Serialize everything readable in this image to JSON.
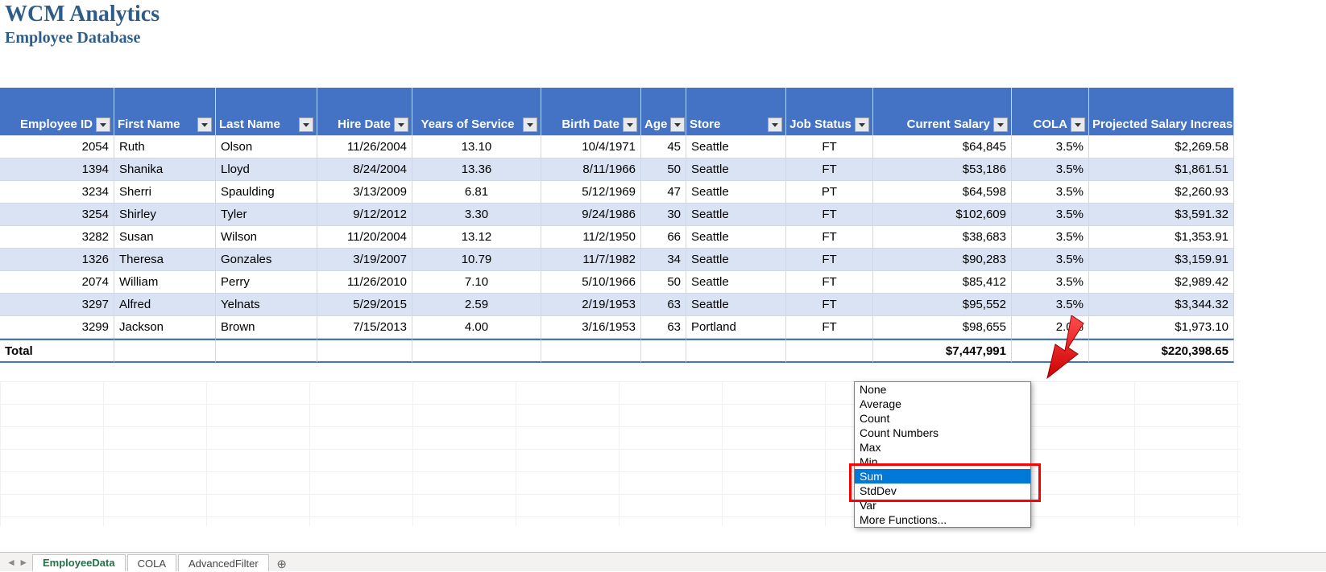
{
  "header": {
    "title1": "WCM Analytics",
    "title2": "Employee Database"
  },
  "columns": [
    {
      "label": "Employee ID",
      "align": "right"
    },
    {
      "label": "First Name",
      "align": "left"
    },
    {
      "label": "Last Name",
      "align": "left"
    },
    {
      "label": "Hire Date",
      "align": "right"
    },
    {
      "label": "Years of Service",
      "align": "center"
    },
    {
      "label": "Birth Date",
      "align": "right"
    },
    {
      "label": "Age",
      "align": "right"
    },
    {
      "label": "Store",
      "align": "left"
    },
    {
      "label": "Job Status",
      "align": "center"
    },
    {
      "label": "Current Salary",
      "align": "right"
    },
    {
      "label": "COLA",
      "align": "right"
    },
    {
      "label": "Projected Salary Increase",
      "align": "right"
    }
  ],
  "rows": [
    {
      "id": "2054",
      "first": "Ruth",
      "last": "Olson",
      "hire": "11/26/2004",
      "yos": "13.10",
      "birth": "10/4/1971",
      "age": "45",
      "store": "Seattle",
      "status": "FT",
      "salary": "$64,845",
      "cola": "3.5%",
      "proj": "$2,269.58"
    },
    {
      "id": "1394",
      "first": "Shanika",
      "last": "Lloyd",
      "hire": "8/24/2004",
      "yos": "13.36",
      "birth": "8/11/1966",
      "age": "50",
      "store": "Seattle",
      "status": "FT",
      "salary": "$53,186",
      "cola": "3.5%",
      "proj": "$1,861.51"
    },
    {
      "id": "3234",
      "first": "Sherri",
      "last": "Spaulding",
      "hire": "3/13/2009",
      "yos": "6.81",
      "birth": "5/12/1969",
      "age": "47",
      "store": "Seattle",
      "status": "PT",
      "salary": "$64,598",
      "cola": "3.5%",
      "proj": "$2,260.93"
    },
    {
      "id": "3254",
      "first": "Shirley",
      "last": "Tyler",
      "hire": "9/12/2012",
      "yos": "3.30",
      "birth": "9/24/1986",
      "age": "30",
      "store": "Seattle",
      "status": "FT",
      "salary": "$102,609",
      "cola": "3.5%",
      "proj": "$3,591.32"
    },
    {
      "id": "3282",
      "first": "Susan",
      "last": "Wilson",
      "hire": "11/20/2004",
      "yos": "13.12",
      "birth": "11/2/1950",
      "age": "66",
      "store": "Seattle",
      "status": "FT",
      "salary": "$38,683",
      "cola": "3.5%",
      "proj": "$1,353.91"
    },
    {
      "id": "1326",
      "first": "Theresa",
      "last": "Gonzales",
      "hire": "3/19/2007",
      "yos": "10.79",
      "birth": "11/7/1982",
      "age": "34",
      "store": "Seattle",
      "status": "FT",
      "salary": "$90,283",
      "cola": "3.5%",
      "proj": "$3,159.91"
    },
    {
      "id": "2074",
      "first": "William",
      "last": "Perry",
      "hire": "11/26/2010",
      "yos": "7.10",
      "birth": "5/10/1966",
      "age": "50",
      "store": "Seattle",
      "status": "FT",
      "salary": "$85,412",
      "cola": "3.5%",
      "proj": "$2,989.42"
    },
    {
      "id": "3297",
      "first": "Alfred",
      "last": "Yelnats",
      "hire": "5/29/2015",
      "yos": "2.59",
      "birth": "2/19/1953",
      "age": "63",
      "store": "Seattle",
      "status": "FT",
      "salary": "$95,552",
      "cola": "3.5%",
      "proj": "$3,344.32"
    },
    {
      "id": "3299",
      "first": "Jackson",
      "last": "Brown",
      "hire": "7/15/2013",
      "yos": "4.00",
      "birth": "3/16/1953",
      "age": "63",
      "store": "Portland",
      "status": "FT",
      "salary": "$98,655",
      "cola": "2.0%",
      "proj": "$1,973.10"
    }
  ],
  "total": {
    "label": "Total",
    "salary": "$7,447,991",
    "proj": "$220,398.65"
  },
  "dropdown": {
    "items": [
      "None",
      "Average",
      "Count",
      "Count Numbers",
      "Max",
      "Min",
      "Sum",
      "StdDev",
      "Var",
      "More Functions..."
    ],
    "selected": "Sum"
  },
  "tabs": {
    "items": [
      "EmployeeData",
      "COLA",
      "AdvancedFilter"
    ],
    "active": 0
  }
}
